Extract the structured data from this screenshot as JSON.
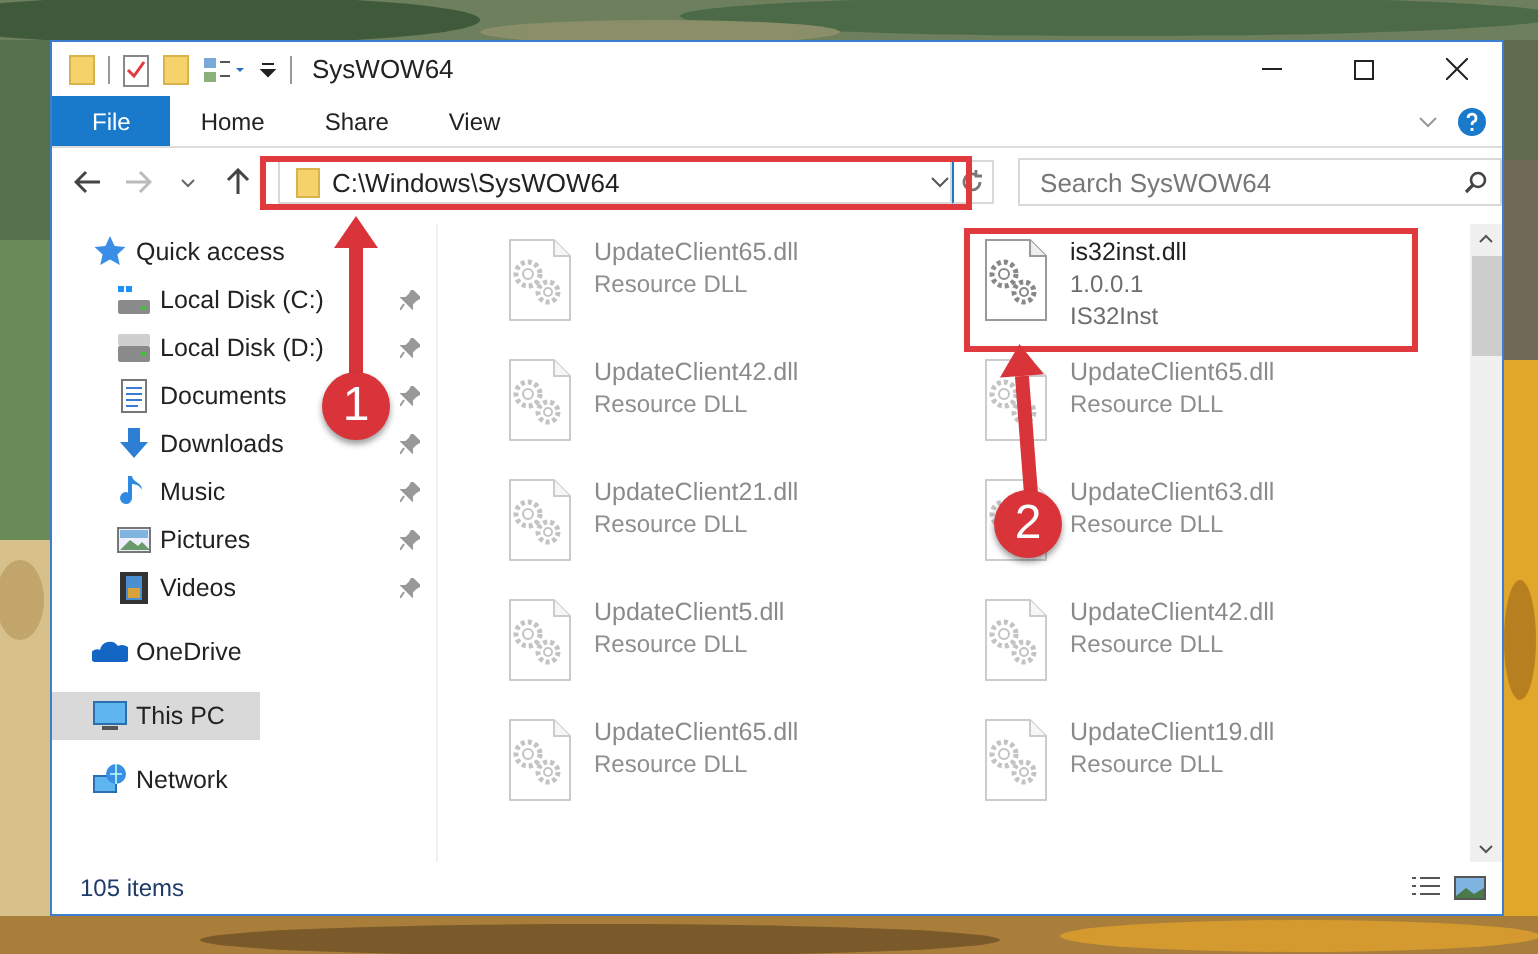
{
  "window": {
    "title": "SysWOW64"
  },
  "ribbon": {
    "tabs": [
      {
        "label": "File",
        "kind": "menu"
      },
      {
        "label": "Home",
        "kind": "tab"
      },
      {
        "label": "Share",
        "kind": "tab"
      },
      {
        "label": "View",
        "kind": "tab"
      }
    ]
  },
  "address": {
    "path": "C:\\Windows\\SysWOW64"
  },
  "search": {
    "placeholder": "Search SysWOW64"
  },
  "sidebar": {
    "items": [
      {
        "label": "Quick access",
        "kind": "star",
        "selected": false,
        "children": [
          {
            "label": "Local Disk (C:)",
            "kind": "systemdrive",
            "pinned": true,
            "selected": false
          },
          {
            "label": "Local Disk (D:)",
            "kind": "drive",
            "pinned": true,
            "selected": false
          },
          {
            "label": "Documents",
            "kind": "documents",
            "pinned": true,
            "selected": false
          },
          {
            "label": "Downloads",
            "kind": "downloads",
            "pinned": true,
            "selected": false
          },
          {
            "label": "Music",
            "kind": "music",
            "pinned": true,
            "selected": false
          },
          {
            "label": "Pictures",
            "kind": "pictures",
            "pinned": true,
            "selected": false
          },
          {
            "label": "Videos",
            "kind": "videos",
            "pinned": true,
            "selected": false
          }
        ]
      },
      {
        "label": "OneDrive",
        "kind": "cloud",
        "selected": false
      },
      {
        "label": "This PC",
        "kind": "pc",
        "selected": true
      },
      {
        "label": "Network",
        "kind": "network",
        "selected": false
      }
    ]
  },
  "files": [
    {
      "name": "UpdateClient65.dll",
      "details": [
        "Resource DLL"
      ],
      "dimmed": true
    },
    {
      "name": "is32inst.dll",
      "details": [
        "1.0.0.1",
        "IS32Inst"
      ],
      "dimmed": false
    },
    {
      "name": "UpdateClient42.dll",
      "details": [
        "Resource DLL"
      ],
      "dimmed": true
    },
    {
      "name": "UpdateClient65.dll",
      "details": [
        "Resource DLL"
      ],
      "dimmed": true
    },
    {
      "name": "UpdateClient21.dll",
      "details": [
        "Resource DLL"
      ],
      "dimmed": true
    },
    {
      "name": "UpdateClient63.dll",
      "details": [
        "Resource DLL"
      ],
      "dimmed": true
    },
    {
      "name": "UpdateClient5.dll",
      "details": [
        "Resource DLL"
      ],
      "dimmed": true
    },
    {
      "name": "UpdateClient42.dll",
      "details": [
        "Resource DLL"
      ],
      "dimmed": true
    },
    {
      "name": "UpdateClient65.dll",
      "details": [
        "Resource DLL"
      ],
      "dimmed": true
    },
    {
      "name": "UpdateClient19.dll",
      "details": [
        "Resource DLL"
      ],
      "dimmed": true
    }
  ],
  "status_bar": {
    "count": "105 items"
  },
  "annotations": [
    {
      "number": "1"
    },
    {
      "number": "2"
    }
  ]
}
